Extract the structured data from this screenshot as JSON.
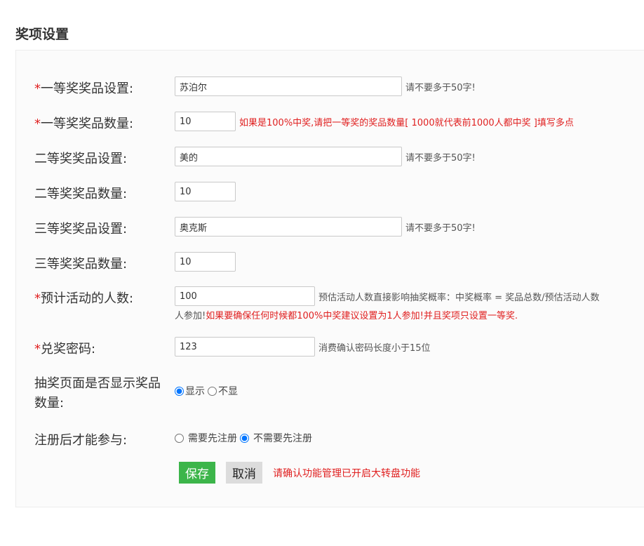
{
  "section_title": "奖项设置",
  "fields": {
    "first_prize_name": {
      "label": "一等奖奖品设置:",
      "required_mark": "*",
      "value": "苏泊尔",
      "hint": "请不要多于50字!"
    },
    "first_prize_qty": {
      "label": "一等奖奖品数量:",
      "required_mark": "*",
      "value": "10",
      "hint": "如果是100%中奖,请把一等奖的奖品数量[ 1000就代表前1000人都中奖 ]填写多点"
    },
    "second_prize_name": {
      "label": "二等奖奖品设置:",
      "value": "美的",
      "hint": "请不要多于50字!"
    },
    "second_prize_qty": {
      "label": "二等奖奖品数量:",
      "value": "10"
    },
    "third_prize_name": {
      "label": "三等奖奖品设置:",
      "value": "奥克斯",
      "hint": "请不要多于50字!"
    },
    "third_prize_qty": {
      "label": "三等奖奖品数量:",
      "value": "10"
    },
    "expected_participants": {
      "label": "预计活动的人数:",
      "required_mark": "*",
      "value": "100",
      "hint": "预估活动人数直接影响抽奖概率：中奖概率 = 奖品总数/预估活动人数",
      "hint_line2_prefix": "人参加!",
      "hint_line2_red": "如果要确保任何时候都100%中奖建议设置为1人参加!并且奖项只设置一等奖."
    },
    "redeem_password": {
      "label": "兑奖密码:",
      "required_mark": "*",
      "value": "123",
      "hint": "消费确认密码长度小于15位"
    },
    "show_prize_qty": {
      "label_line1": "抽奖页面是否显示奖品",
      "label_line2": "数量:",
      "option_show": "显示",
      "option_hide": "不显",
      "selected": "显示"
    },
    "register_required": {
      "label": "注册后才能参与:",
      "option_need": "需要先注册",
      "option_no_need": "不需要先注册",
      "selected": "不需要先注册"
    }
  },
  "actions": {
    "save_label": "保存",
    "cancel_label": "取消",
    "notice": "请确认功能管理已开启大转盘功能"
  },
  "colors": {
    "required": "#e02020",
    "save_button": "#3cb54a",
    "cancel_button": "#dcdcdc"
  }
}
